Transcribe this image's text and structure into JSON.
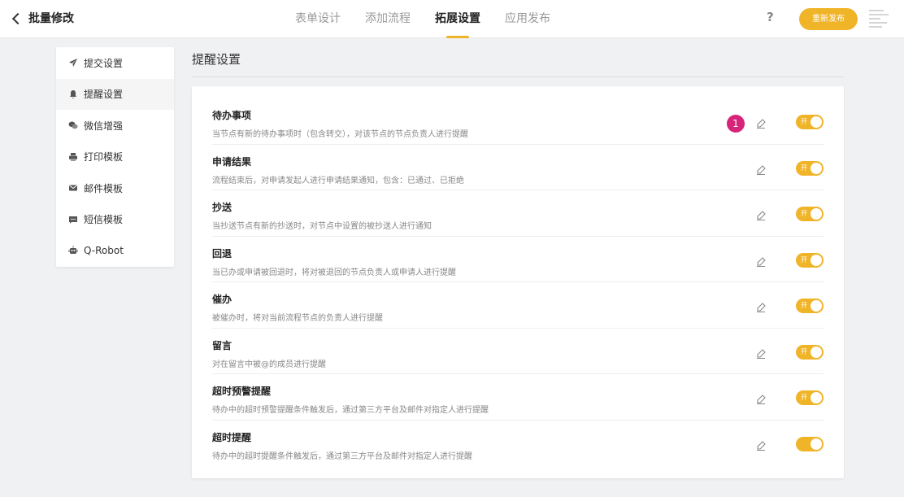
{
  "header": {
    "back_label": "批量修改",
    "tabs": [
      "表单设计",
      "添加流程",
      "拓展设置",
      "应用发布"
    ],
    "active_tab": 2,
    "help": "?",
    "publish_label": "重新发布"
  },
  "sidebar": {
    "items": [
      {
        "label": "提交设置",
        "icon": "send-icon"
      },
      {
        "label": "提醒设置",
        "icon": "bell-icon"
      },
      {
        "label": "微信增强",
        "icon": "wechat-icon"
      },
      {
        "label": "打印模板",
        "icon": "printer-icon"
      },
      {
        "label": "邮件模板",
        "icon": "mail-icon"
      },
      {
        "label": "短信模板",
        "icon": "sms-icon"
      },
      {
        "label": "Q-Robot",
        "icon": "robot-icon"
      }
    ],
    "active_index": 1
  },
  "main": {
    "title": "提醒设置",
    "rows": [
      {
        "name": "待办事项",
        "desc": "当节点有新的待办事项时（包含转交），对该节点的节点负责人进行提醒",
        "toggle_text": "开",
        "badge": "1"
      },
      {
        "name": "申请结果",
        "desc": "流程结束后，对申请发起人进行申请结果通知，包含：已通过、已拒绝",
        "toggle_text": "开"
      },
      {
        "name": "抄送",
        "desc": "当抄送节点有新的抄送时，对节点中设置的被抄送人进行通知",
        "toggle_text": "开"
      },
      {
        "name": "回退",
        "desc": "当已办或申请被回退时，将对被退回的节点负责人或申请人进行提醒",
        "toggle_text": "开"
      },
      {
        "name": "催办",
        "desc": "被催办时，将对当前流程节点的负责人进行提醒",
        "toggle_text": "开"
      },
      {
        "name": "留言",
        "desc": "对在留言中被@的成员进行提醒",
        "toggle_text": "开"
      },
      {
        "name": "超时预警提醒",
        "desc": "待办中的超时预警提醒条件触发后，通过第三方平台及邮件对指定人进行提醒",
        "toggle_text": "开"
      },
      {
        "name": "超时提醒",
        "desc": "待办中的超时提醒条件触发后，通过第三方平台及邮件对指定人进行提醒",
        "toggle_text": ""
      }
    ]
  },
  "colors": {
    "accent": "#f0b429",
    "badge": "#d6247a"
  }
}
